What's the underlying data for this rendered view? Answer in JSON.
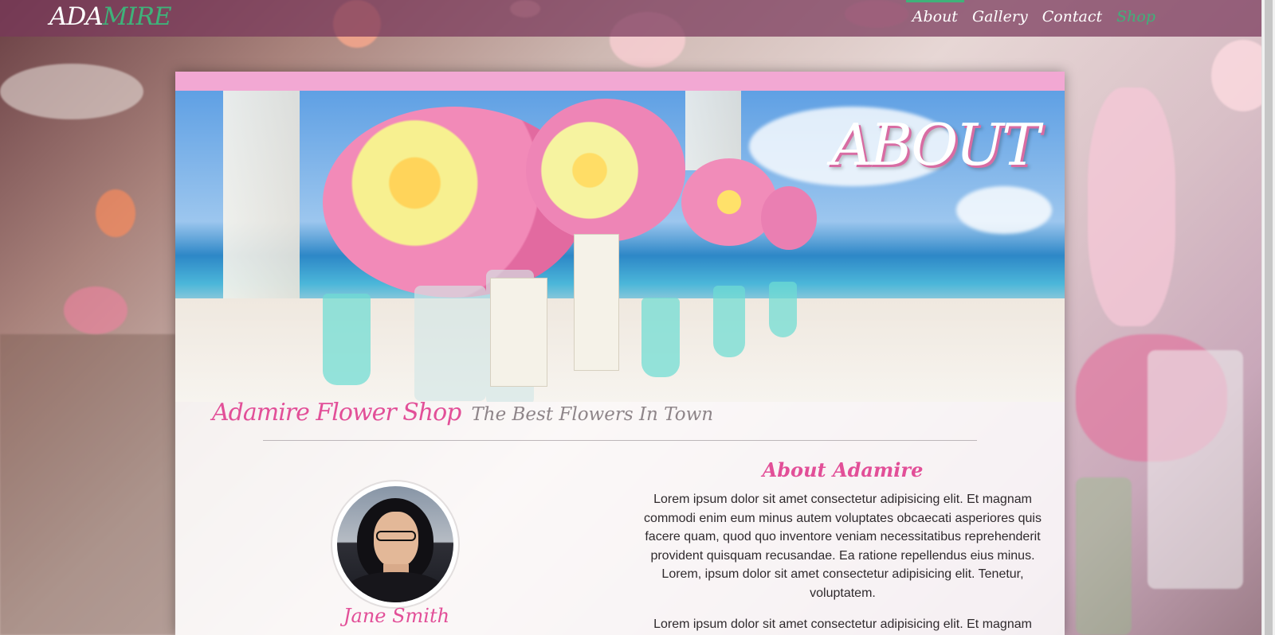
{
  "brand": {
    "part1": "ADA",
    "part2": "MIRE"
  },
  "nav": {
    "about": "About",
    "gallery": "Gallery",
    "contact": "Contact",
    "shop": "Shop"
  },
  "hero": {
    "title": "ABOUT"
  },
  "tagline": {
    "shop_name": "Adamire Flower Shop",
    "slogan": "The Best Flowers In Town"
  },
  "profile": {
    "name": "Jane Smith"
  },
  "about": {
    "heading": "About Adamire",
    "paragraphs": [
      "Lorem ipsum dolor sit amet consectetur adipisicing elit. Et magnam commodi enim eum minus autem voluptates obcaecati asperiores quis facere quam, quod quo inventore veniam necessitatibus reprehenderit provident quisquam recusandae. Ea ratione repellendus eius minus. Lorem, ipsum dolor sit amet consectetur adipisicing elit. Tenetur, voluptatem.",
      "Lorem ipsum dolor sit amet consectetur adipisicing elit. Et magnam commodi enim eum minus autem voluptates obcaecati asperiores quis"
    ]
  },
  "colors": {
    "accent_pink": "#e24f98",
    "accent_green": "#3fb27a",
    "nav_bg": "#78375a",
    "card_top": "#f2a8d3"
  },
  "icons": {
    "avatar": "avatar-photo"
  }
}
